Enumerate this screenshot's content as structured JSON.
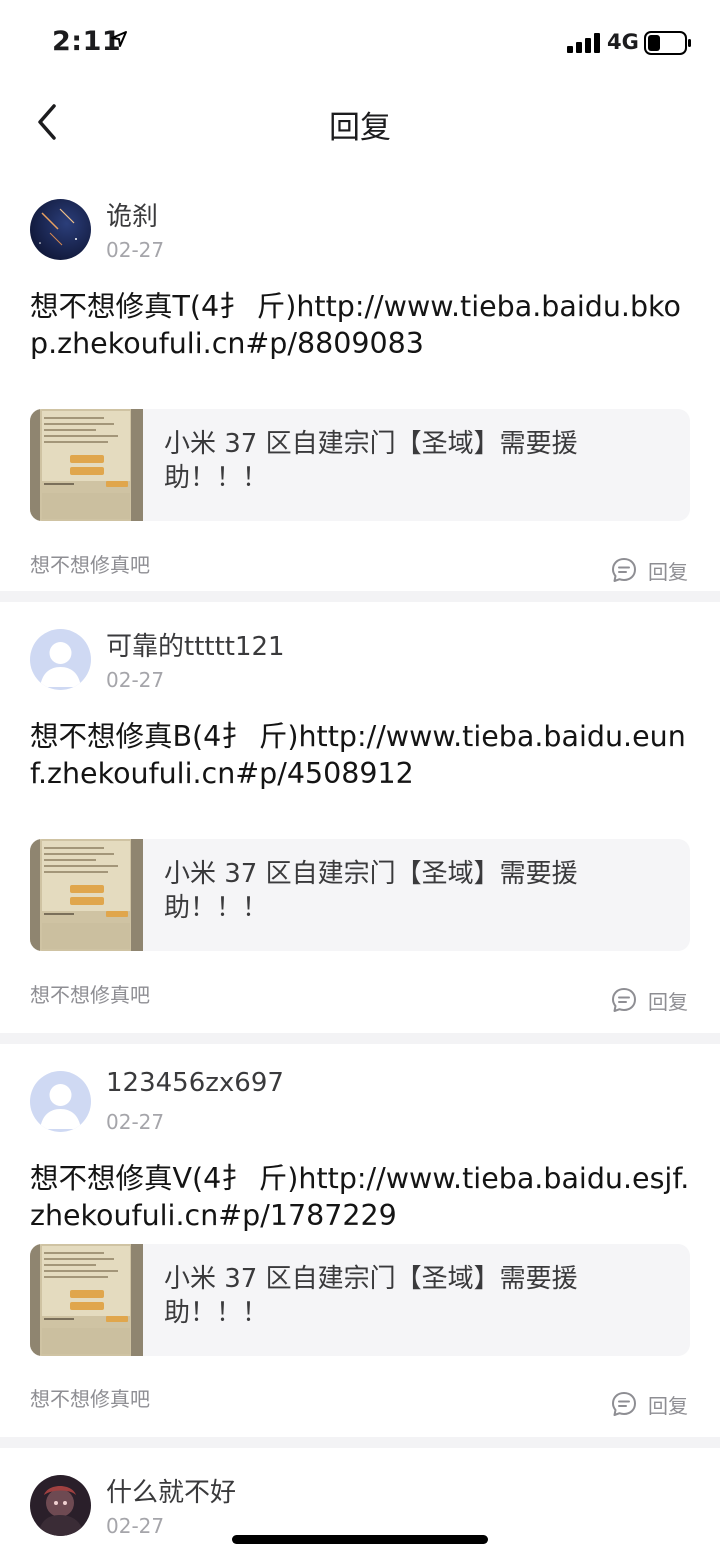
{
  "status_bar": {
    "time": "2:11",
    "network": "4G"
  },
  "nav": {
    "title": "回复"
  },
  "posts": [
    {
      "author": "诡刹",
      "date": "02-27",
      "text": "想不想修真T(4扌 斤)http://www.tieba.baidu.bkop.zhekoufuli.cn#p/8809083",
      "card_text": "小米 37 区自建宗门【圣域】需要援助！！！",
      "source": "想不想修真吧",
      "reply_label": "回复"
    },
    {
      "author": "可靠的ttttt121",
      "date": "02-27",
      "text": "想不想修真B(4扌 斤)http://www.tieba.baidu.eunf.zhekoufuli.cn#p/4508912",
      "card_text": "小米 37 区自建宗门【圣域】需要援助！！！",
      "source": "想不想修真吧",
      "reply_label": "回复"
    },
    {
      "author": "123456zx697",
      "date": "02-27",
      "text": "想不想修真V(4扌 斤)http://www.tieba.baidu.esjf.zhekoufuli.cn#p/1787229",
      "card_text": "小米 37 区自建宗门【圣域】需要援助！！！",
      "source": "想不想修真吧",
      "reply_label": "回复"
    },
    {
      "author": "什么就不好",
      "date": "02-27"
    }
  ]
}
